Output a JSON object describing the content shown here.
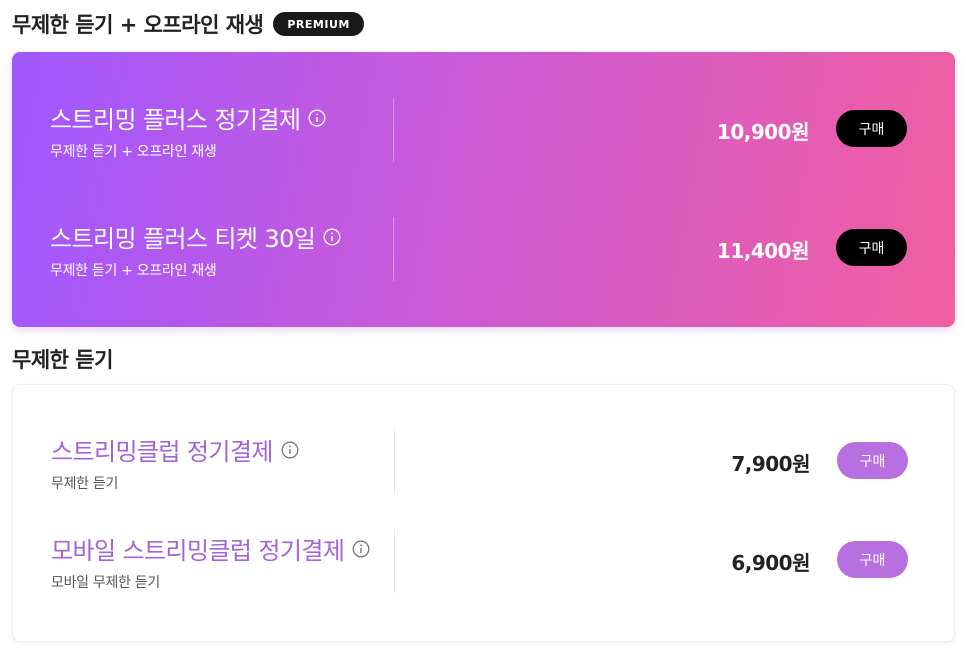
{
  "premium_section": {
    "title": "무제한 듣기 + 오프라인 재생",
    "badge": "PREMIUM",
    "products": [
      {
        "name": "스트리밍 플러스 정기결제",
        "description": "무제한 듣기 + 오프라인 재생",
        "price": "10,900원",
        "button": "구매",
        "info_icon": "info-icon"
      },
      {
        "name": "스트리밍 플러스 티켓 30일",
        "description": "무제한 듣기 + 오프라인 재생",
        "price": "11,400원",
        "button": "구매",
        "info_icon": "info-icon"
      }
    ]
  },
  "basic_section": {
    "title": "무제한 듣기",
    "products": [
      {
        "name": "스트리밍클럽 정기결제",
        "description": "무제한 듣기",
        "price": "7,900원",
        "button": "구매",
        "info_icon": "info-icon"
      },
      {
        "name": "모바일 스트리밍클럽 정기결제",
        "description": "모바일 무제한 듣기",
        "price": "6,900원",
        "button": "구매",
        "info_icon": "info-icon"
      }
    ]
  },
  "colors": {
    "premium_gradient_start": "#a057ff",
    "premium_gradient_end": "#f25e9f",
    "premium_button": "#000000",
    "basic_button": "#b86fe0",
    "basic_product_name": "#a463d8"
  }
}
